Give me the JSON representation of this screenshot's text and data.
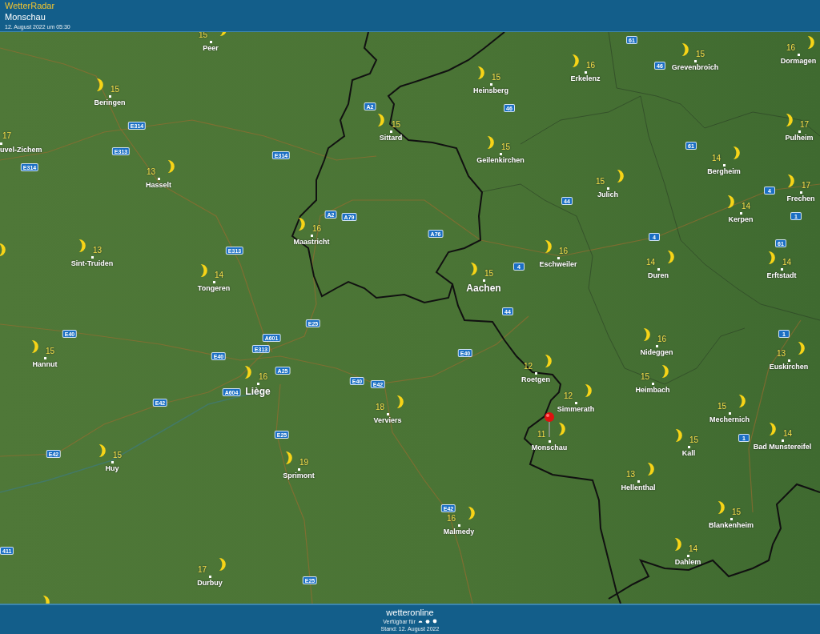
{
  "header": {
    "app_name": "WetterRadar",
    "location": "Monschau",
    "timestamp": "12. August 2022 um 05:30"
  },
  "map": {
    "cities": [
      {
        "name": "Peer",
        "temp": "15",
        "kind": "town",
        "selected": false
      },
      {
        "name": "Beringen",
        "temp": "15",
        "kind": "town",
        "selected": false
      },
      {
        "name": "uvel-Zichem",
        "temp": "17",
        "kind": "town",
        "selected": false
      },
      {
        "name": "Hasselt",
        "temp": "13",
        "kind": "town",
        "selected": false
      },
      {
        "name": "Sint-Truiden",
        "temp": "13",
        "kind": "town",
        "selected": false
      },
      {
        "name": "Tongeren",
        "temp": "14",
        "kind": "town",
        "selected": false
      },
      {
        "name": "Maastricht",
        "temp": "16",
        "kind": "town",
        "selected": false
      },
      {
        "name": "Sittard",
        "temp": "15",
        "kind": "town",
        "selected": false
      },
      {
        "name": "Heinsberg",
        "temp": "15",
        "kind": "town",
        "selected": false
      },
      {
        "name": "Erkelenz",
        "temp": "16",
        "kind": "town",
        "selected": false
      },
      {
        "name": "Grevenbroich",
        "temp": "15",
        "kind": "town",
        "selected": false
      },
      {
        "name": "Dormagen",
        "temp": "16",
        "kind": "town",
        "selected": false
      },
      {
        "name": "Geilenkirchen",
        "temp": "15",
        "kind": "town",
        "selected": false
      },
      {
        "name": "Pulheim",
        "temp": "17",
        "kind": "town",
        "selected": false
      },
      {
        "name": "Bergheim",
        "temp": "14",
        "kind": "town",
        "selected": false
      },
      {
        "name": "Julich",
        "temp": "15",
        "kind": "town",
        "selected": false
      },
      {
        "name": "Frechen",
        "temp": "17",
        "kind": "town",
        "selected": false
      },
      {
        "name": "Kerpen",
        "temp": "14",
        "kind": "town",
        "selected": false
      },
      {
        "name": "Eschweiler",
        "temp": "16",
        "kind": "town",
        "selected": false
      },
      {
        "name": "Aachen",
        "temp": "15",
        "kind": "major",
        "selected": false
      },
      {
        "name": "Duren",
        "temp": "14",
        "kind": "town",
        "selected": false
      },
      {
        "name": "Erftstadt",
        "temp": "14",
        "kind": "town",
        "selected": false
      },
      {
        "name": "Hannut",
        "temp": "15",
        "kind": "town",
        "selected": false
      },
      {
        "name": "Liège",
        "temp": "16",
        "kind": "major",
        "selected": false
      },
      {
        "name": "Verviers",
        "temp": "18",
        "kind": "town",
        "selected": false
      },
      {
        "name": "Huy",
        "temp": "15",
        "kind": "town",
        "selected": false
      },
      {
        "name": "Sprimont",
        "temp": "19",
        "kind": "town",
        "selected": false
      },
      {
        "name": "Durbuy",
        "temp": "17",
        "kind": "town",
        "selected": false
      },
      {
        "name": "Roetgen",
        "temp": "12",
        "kind": "town",
        "selected": false
      },
      {
        "name": "Simmerath",
        "temp": "12",
        "kind": "town",
        "selected": false
      },
      {
        "name": "Monschau",
        "temp": "11",
        "kind": "town",
        "selected": true
      },
      {
        "name": "Nideggen",
        "temp": "16",
        "kind": "town",
        "selected": false
      },
      {
        "name": "Heimbach",
        "temp": "15",
        "kind": "town",
        "selected": false
      },
      {
        "name": "Euskirchen",
        "temp": "13",
        "kind": "town",
        "selected": false
      },
      {
        "name": "Mechernich",
        "temp": "15",
        "kind": "town",
        "selected": false
      },
      {
        "name": "Bad Munstereifel",
        "temp": "14",
        "kind": "town",
        "selected": false
      },
      {
        "name": "Kall",
        "temp": "15",
        "kind": "town",
        "selected": false
      },
      {
        "name": "Hellenthal",
        "temp": "13",
        "kind": "town",
        "selected": false
      },
      {
        "name": "Blankenheim",
        "temp": "15",
        "kind": "town",
        "selected": false
      },
      {
        "name": "Dahlem",
        "temp": "14",
        "kind": "town",
        "selected": false
      },
      {
        "name": "Malmedy",
        "temp": "16",
        "kind": "town",
        "selected": false
      }
    ],
    "road_signs": [
      "E314",
      "E313",
      "E314",
      "E314",
      "A2",
      "A2",
      "A79",
      "E313",
      "A76",
      "61",
      "46",
      "46",
      "61",
      "44",
      "4",
      "1",
      "4",
      "61",
      "4",
      "44",
      "E25",
      "E40",
      "A601",
      "E40",
      "E313",
      "A25",
      "E40",
      "E42",
      "A604",
      "E42",
      "E25",
      "E42",
      "E40",
      "1",
      "1",
      "E42",
      "E25",
      "411"
    ]
  },
  "footer": {
    "logo": "wetteronline",
    "availability": "Verfügbar für",
    "updated": "Stand: 12. August 2022"
  }
}
